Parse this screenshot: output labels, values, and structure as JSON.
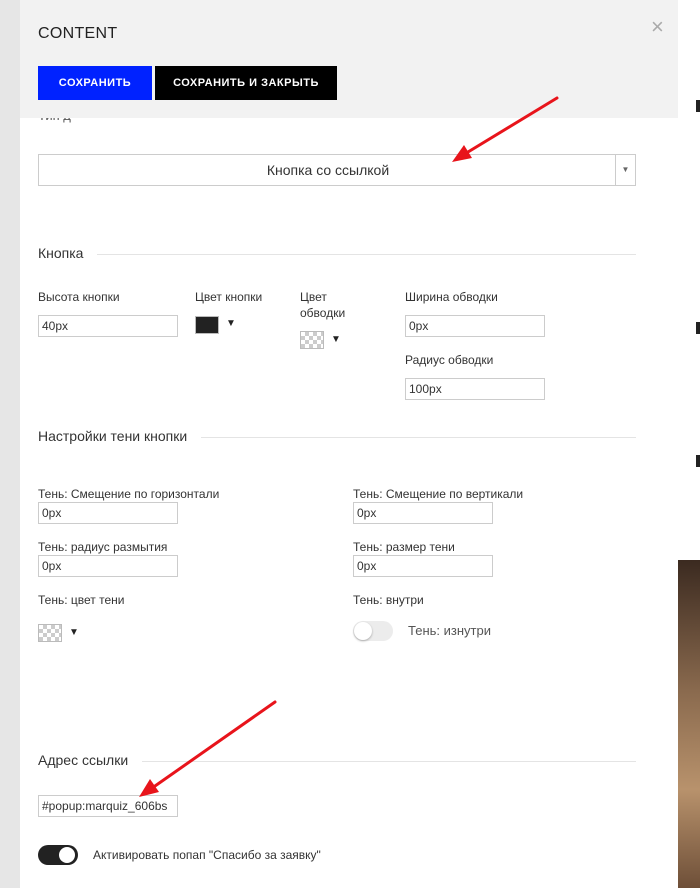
{
  "panel": {
    "title": "CONTENT",
    "close_icon": "×",
    "save_label": "СОХРАНИТЬ",
    "save_close_label": "СОХРАНИТЬ И ЗАКРЫТЬ",
    "partial_label": "Тип д..."
  },
  "type_select": {
    "value": "Кнопка со ссылкой",
    "arrow": "▼"
  },
  "button_section": {
    "title": "Кнопка",
    "height_label": "Высота кнопки",
    "height_value": "40px",
    "color_label": "Цвет кнопки",
    "border_color_label": "Цвет обводки",
    "border_width_label": "Ширина обводки",
    "border_width_value": "0px",
    "border_radius_label": "Радиус обводки",
    "border_radius_value": "100px"
  },
  "shadow_section": {
    "title": "Настройки тени кнопки",
    "offset_x_label": "Тень: Смещение по горизонтали",
    "offset_x_value": "0px",
    "offset_y_label": "Тень: Смещение по вертикали",
    "offset_y_value": "0px",
    "blur_label": "Тень: радиус размытия",
    "blur_value": "0px",
    "size_label": "Тень: размер тени",
    "size_value": "0px",
    "color_label": "Тень: цвет тени",
    "inset_label": "Тень: внутри",
    "inset_toggle_label": "Тень: изнутри",
    "inset_enabled": false
  },
  "link_section": {
    "title": "Адрес ссылки",
    "url_value": "#popup:marquiz_606bs",
    "thanks_popup_label": "Активировать попап \"Спасибо за заявку\"",
    "thanks_popup_enabled": true
  },
  "dropdown_glyph": "▼",
  "colors": {
    "save_button": "#0022ff",
    "save_close_button": "#000000",
    "annotation_arrow": "#e8141b",
    "button_color": "#222222"
  }
}
